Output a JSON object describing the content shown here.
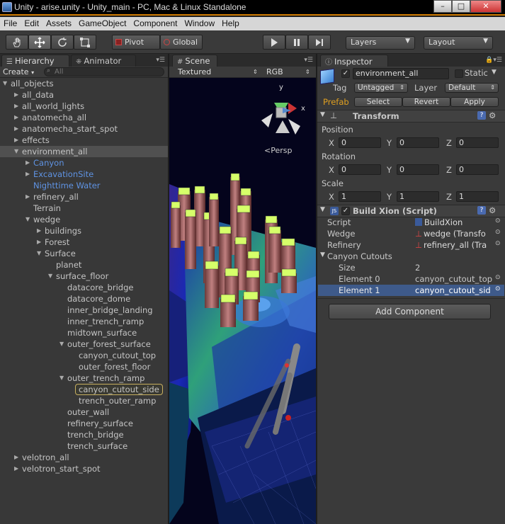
{
  "window": {
    "title": "Unity - arise.unity - Unity_main - PC, Mac & Linux Standalone",
    "minimize": "–",
    "maximize": "□",
    "close": "✕"
  },
  "menu": [
    "File",
    "Edit",
    "Assets",
    "GameObject",
    "Component",
    "Window",
    "Help"
  ],
  "toolbar": {
    "pivot": "Pivot",
    "global": "Global",
    "layers": "Layers",
    "layout": "Layout"
  },
  "hierarchy": {
    "tab_label": "Hierarchy",
    "animator_tab": "Animator",
    "create": "Create",
    "search_placeholder": "All",
    "items": [
      {
        "label": "all_objects",
        "depth": 0,
        "arrow": "open"
      },
      {
        "label": "all_data",
        "depth": 1,
        "arrow": "closed"
      },
      {
        "label": "all_world_lights",
        "depth": 1,
        "arrow": "closed"
      },
      {
        "label": "anatomecha_all",
        "depth": 1,
        "arrow": "closed"
      },
      {
        "label": "anatomecha_start_spot",
        "depth": 1,
        "arrow": "closed"
      },
      {
        "label": "effects",
        "depth": 1,
        "arrow": "closed"
      },
      {
        "label": "environment_all",
        "depth": 1,
        "arrow": "open",
        "selected": true
      },
      {
        "label": "Canyon",
        "depth": 2,
        "arrow": "closed",
        "color": "blue"
      },
      {
        "label": "ExcavationSite",
        "depth": 2,
        "arrow": "closed",
        "color": "blue"
      },
      {
        "label": "Nighttime Water",
        "depth": 2,
        "arrow": "none",
        "color": "blue"
      },
      {
        "label": "refinery_all",
        "depth": 2,
        "arrow": "closed"
      },
      {
        "label": "Terrain",
        "depth": 2,
        "arrow": "none"
      },
      {
        "label": "wedge",
        "depth": 2,
        "arrow": "open"
      },
      {
        "label": "buildings",
        "depth": 3,
        "arrow": "closed"
      },
      {
        "label": "Forest",
        "depth": 3,
        "arrow": "closed"
      },
      {
        "label": "Surface",
        "depth": 3,
        "arrow": "open"
      },
      {
        "label": "planet",
        "depth": 4,
        "arrow": "none"
      },
      {
        "label": "surface_floor",
        "depth": 4,
        "arrow": "open"
      },
      {
        "label": "datacore_bridge",
        "depth": 5,
        "arrow": "none"
      },
      {
        "label": "datacore_dome",
        "depth": 5,
        "arrow": "none"
      },
      {
        "label": "inner_bridge_landing",
        "depth": 5,
        "arrow": "none"
      },
      {
        "label": "inner_trench_ramp",
        "depth": 5,
        "arrow": "none"
      },
      {
        "label": "midtown_surface",
        "depth": 5,
        "arrow": "none"
      },
      {
        "label": "outer_forest_surface",
        "depth": 5,
        "arrow": "open"
      },
      {
        "label": "canyon_cutout_top",
        "depth": 6,
        "arrow": "none"
      },
      {
        "label": "outer_forest_floor",
        "depth": 6,
        "arrow": "none"
      },
      {
        "label": "outer_trench_ramp",
        "depth": 5,
        "arrow": "open"
      },
      {
        "label": "canyon_cutout_side",
        "depth": 6,
        "arrow": "none",
        "boxed": true
      },
      {
        "label": "trench_outer_ramp",
        "depth": 6,
        "arrow": "none"
      },
      {
        "label": "outer_wall",
        "depth": 5,
        "arrow": "none"
      },
      {
        "label": "refinery_surface",
        "depth": 5,
        "arrow": "none"
      },
      {
        "label": "trench_bridge",
        "depth": 5,
        "arrow": "none"
      },
      {
        "label": "trench_surface",
        "depth": 5,
        "arrow": "none"
      },
      {
        "label": "velotron_all",
        "depth": 1,
        "arrow": "closed"
      },
      {
        "label": "velotron_start_spot",
        "depth": 1,
        "arrow": "closed"
      }
    ]
  },
  "scene": {
    "tab_label": "Scene",
    "render_mode": "Textured",
    "color_mode": "RGB",
    "persp": "Persp",
    "gizmo_y": "y",
    "gizmo_x": "x"
  },
  "inspector": {
    "tab_label": "Inspector",
    "object_name": "environment_all",
    "static_label": "Static",
    "tag_label": "Tag",
    "tag_value": "Untagged",
    "layer_label": "Layer",
    "layer_value": "Default",
    "prefab_label": "Prefab",
    "prefab_select": "Select",
    "prefab_revert": "Revert",
    "prefab_apply": "Apply",
    "transform": {
      "title": "Transform",
      "position_label": "Position",
      "rotation_label": "Rotation",
      "scale_label": "Scale",
      "axis_x": "X",
      "axis_y": "Y",
      "axis_z": "Z",
      "position": [
        "0",
        "0",
        "0"
      ],
      "rotation": [
        "0",
        "0",
        "0"
      ],
      "scale": [
        "1",
        "1",
        "1"
      ]
    },
    "script": {
      "title": "Build Xion (Script)",
      "js_badge": "JS",
      "script_label": "Script",
      "script_value": "BuildXion",
      "wedge_label": "Wedge",
      "wedge_value": "wedge (Transfo",
      "refinery_label": "Refinery",
      "refinery_value": "refinery_all (Tra",
      "cutouts_label": "Canyon Cutouts",
      "size_label": "Size",
      "size_value": "2",
      "element0_label": "Element 0",
      "element0_value": "canyon_cutout_top",
      "element1_label": "Element 1",
      "element1_value": "canyon_cutout_sid"
    },
    "add_component": "Add Component"
  }
}
